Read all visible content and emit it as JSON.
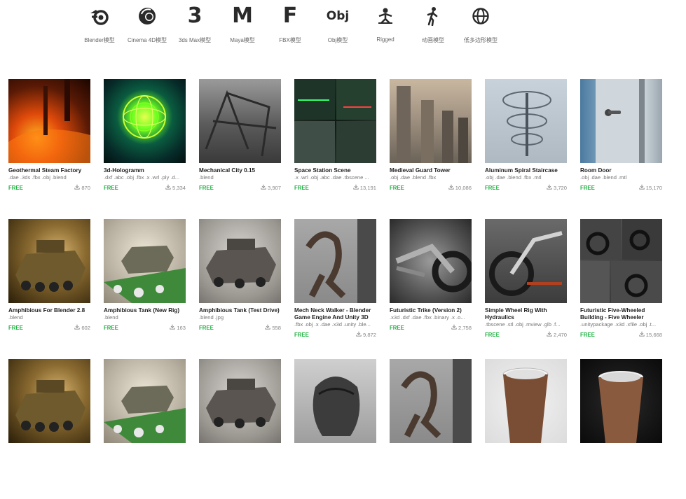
{
  "nav": [
    {
      "label": "Blender模型",
      "icon": "blender-icon"
    },
    {
      "label": "Cinema 4D模型",
      "icon": "cinema4d-icon"
    },
    {
      "label": "3ds Max模型",
      "icon": "3dsmax-icon",
      "glyph": "3"
    },
    {
      "label": "Maya模型",
      "icon": "maya-icon",
      "glyph": "M"
    },
    {
      "label": "FBX模型",
      "icon": "fbx-icon",
      "glyph": "F"
    },
    {
      "label": "Obj模型",
      "icon": "obj-icon",
      "glyph": "Obj"
    },
    {
      "label": "Rigged",
      "icon": "rigged-figure-icon"
    },
    {
      "label": "动画模型",
      "icon": "walking-figure-icon"
    },
    {
      "label": "低多边形模型",
      "icon": "globe-icon"
    }
  ],
  "free_label": "FREE",
  "models": [
    {
      "title": "Geothermal Steam Factory",
      "formats": ".dae .3ds .fbx .obj .blend",
      "downloads": "870",
      "art": "t-geo"
    },
    {
      "title": "3d-Hologramm",
      "formats": ".dxf .abc .obj .fbx .x .wrl .ply .d...",
      "downloads": "5,334",
      "art": "t-holo"
    },
    {
      "title": "Mechanical City 0.15",
      "formats": ".blend",
      "downloads": "3,907",
      "art": "t-mech"
    },
    {
      "title": "Space Station Scene",
      "formats": ".x .wrl .obj .abc .dae .tbscene ...",
      "downloads": "13,191",
      "art": "t-space"
    },
    {
      "title": "Medieval Guard Tower",
      "formats": ".obj .dae .blend .fbx",
      "downloads": "10,086",
      "art": "t-tower"
    },
    {
      "title": "Aluminum Spiral Staircase",
      "formats": ".obj .dae .blend .fbx .mtl",
      "downloads": "3,720",
      "art": "t-stair"
    },
    {
      "title": "Room Door",
      "formats": ".obj .dae .blend .mtl",
      "downloads": "15,170",
      "art": "t-door"
    },
    {
      "title": "Amphibious For Blender 2.8",
      "formats": ".blend",
      "downloads": "602",
      "art": "t-tank1"
    },
    {
      "title": "Amphibious Tank (New Rig)",
      "formats": ".blend",
      "downloads": "163",
      "art": "t-tank2"
    },
    {
      "title": "Amphibious Tank (Test Drive)",
      "formats": ".blend .jpg",
      "downloads": "558",
      "art": "t-tank3"
    },
    {
      "title": "Mech Neck Walker - Blender Game Engine And Unity 3D",
      "formats": ".fbx .obj .x .dae .x3d .unity .ble...",
      "downloads": "9,872",
      "art": "t-walker"
    },
    {
      "title": "Futuristic Trike (Version 2)",
      "formats": ".x3d .dxf .dae .fbx .binary .x .o...",
      "downloads": "2,758",
      "art": "t-trike"
    },
    {
      "title": "Simple Wheel Rig With Hydraulics",
      "formats": ".tbscene .stl .obj .mview .glb .f...",
      "downloads": "2,470",
      "art": "t-wheel"
    },
    {
      "title": "Futuristic Five-Wheeled Building - Five Wheeler",
      "formats": ".unitypackage .x3d .xfile .obj .t...",
      "downloads": "15,668",
      "art": "t-five"
    },
    {
      "art": "t-tank1"
    },
    {
      "art": "t-tank2"
    },
    {
      "art": "t-tank3"
    },
    {
      "art": "t-alien"
    },
    {
      "art": "t-walker"
    },
    {
      "art": "t-cup1"
    },
    {
      "art": "t-cup2"
    }
  ]
}
